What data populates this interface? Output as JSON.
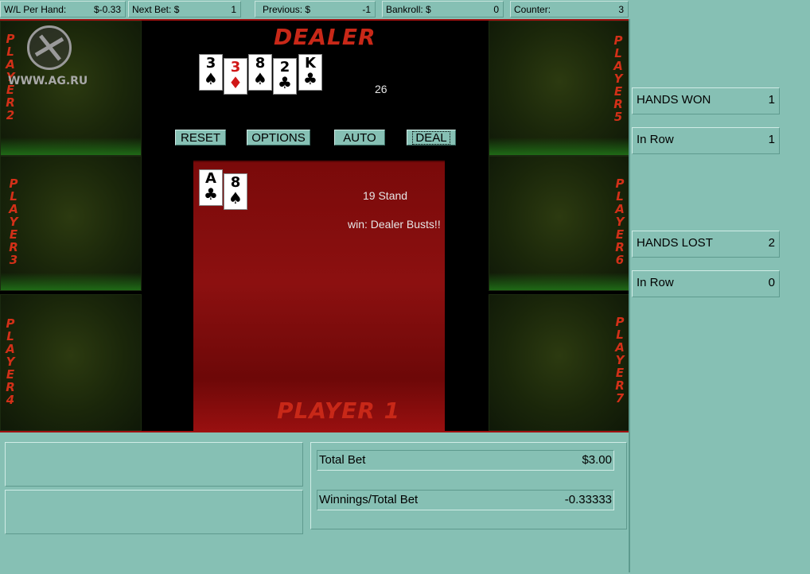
{
  "top_bar": [
    {
      "label": "W/L Per Hand:",
      "value": "$-0.33"
    },
    {
      "label": "Next Bet: $",
      "value": "1"
    },
    {
      "label": "Previous: $",
      "value": "-1"
    },
    {
      "label": "Bankroll: $",
      "value": "0"
    },
    {
      "label": "Counter:",
      "value": "3"
    }
  ],
  "logo": {
    "text": "WWW.AG.RU"
  },
  "dealer": {
    "title": "DEALER",
    "total": "26",
    "cards": [
      {
        "rank": "3",
        "suit": "♠",
        "color": "black"
      },
      {
        "rank": "3",
        "suit": "♦",
        "color": "red"
      },
      {
        "rank": "8",
        "suit": "♠",
        "color": "black"
      },
      {
        "rank": "2",
        "suit": "♣",
        "color": "black"
      },
      {
        "rank": "K",
        "suit": "♣",
        "color": "black"
      }
    ]
  },
  "controls": {
    "reset": "RESET",
    "options": "OPTIONS",
    "auto": "AUTO",
    "deal": "DEAL"
  },
  "player1": {
    "title": "PLAYER 1",
    "hand_status": "19  Stand",
    "result": "win: Dealer Busts!!",
    "cards": [
      {
        "rank": "A",
        "suit": "♣",
        "color": "black"
      },
      {
        "rank": "8",
        "suit": "♠",
        "color": "black"
      }
    ]
  },
  "seats": {
    "player2": "PLAYER2",
    "player3": "PLAYER3",
    "player4": "PLAYER4",
    "player5": "PLAYER5",
    "player6": "PLAYER6",
    "player7": "PLAYER7"
  },
  "stats": {
    "hands_won": {
      "label": "HANDS WON",
      "value": "1"
    },
    "won_in_row": {
      "label": "In Row",
      "value": "1"
    },
    "hands_lost": {
      "label": "HANDS LOST",
      "value": "2"
    },
    "lost_in_row": {
      "label": "In Row",
      "value": "0"
    }
  },
  "totals": {
    "total_bet": {
      "label": "Total Bet",
      "value": "$3.00"
    },
    "winnings_ratio": {
      "label": "Winnings/Total Bet",
      "value": "-0.33333"
    }
  },
  "colors": {
    "felt_red": "#8c1010",
    "panel": "#86c0b4",
    "label_red": "#d23018"
  }
}
